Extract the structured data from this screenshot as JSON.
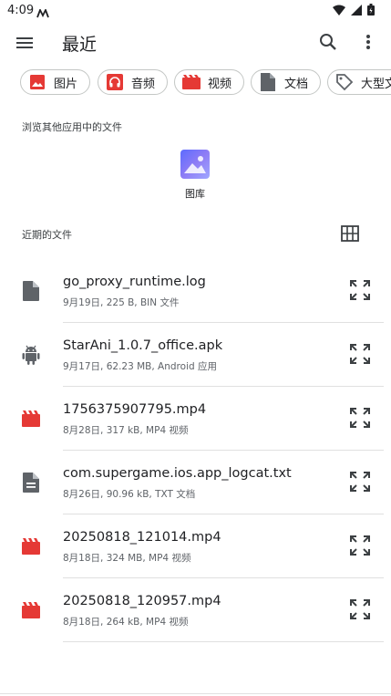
{
  "status": {
    "time": "4:09"
  },
  "app_bar": {
    "title": "最近"
  },
  "chips": [
    {
      "label": "图片",
      "icon": "image-icon",
      "color": "#e53935"
    },
    {
      "label": "音频",
      "icon": "headphones-icon",
      "color": "#e53935"
    },
    {
      "label": "视频",
      "icon": "movie-icon",
      "color": "#e53935"
    },
    {
      "label": "文档",
      "icon": "document-icon",
      "color": "#5f6368"
    },
    {
      "label": "大型文",
      "icon": "tag-icon",
      "color": "#5f6368"
    }
  ],
  "other_apps": {
    "heading": "浏览其他应用中的文件",
    "apps": [
      {
        "label": "图库",
        "icon": "gallery-icon"
      }
    ]
  },
  "recent": {
    "heading": "近期的文件",
    "files": [
      {
        "name": "go_proxy_runtime.log",
        "meta": "9月19日, 225 B, BIN 文件",
        "icon": "file-icon"
      },
      {
        "name": "StarAni_1.0.7_office.apk",
        "meta": "9月17日, 62.23 MB, Android 应用",
        "icon": "android-icon"
      },
      {
        "name": "1756375907795.mp4",
        "meta": "8月28日, 317 kB, MP4 视频",
        "icon": "movie-icon"
      },
      {
        "name": "com.supergame.ios.app_logcat.txt",
        "meta": "8月26日, 90.96 kB, TXT 文档",
        "icon": "text-file-icon"
      },
      {
        "name": "20250818_121014.mp4",
        "meta": "8月18日, 324 MB, MP4 视频",
        "icon": "movie-icon"
      },
      {
        "name": "20250818_120957.mp4",
        "meta": "8月18日, 264 kB, MP4 视频",
        "icon": "movie-icon"
      }
    ]
  },
  "colors": {
    "video_red": "#e53935",
    "icon_grey": "#5f6368",
    "divider": "#e0e0e0"
  }
}
